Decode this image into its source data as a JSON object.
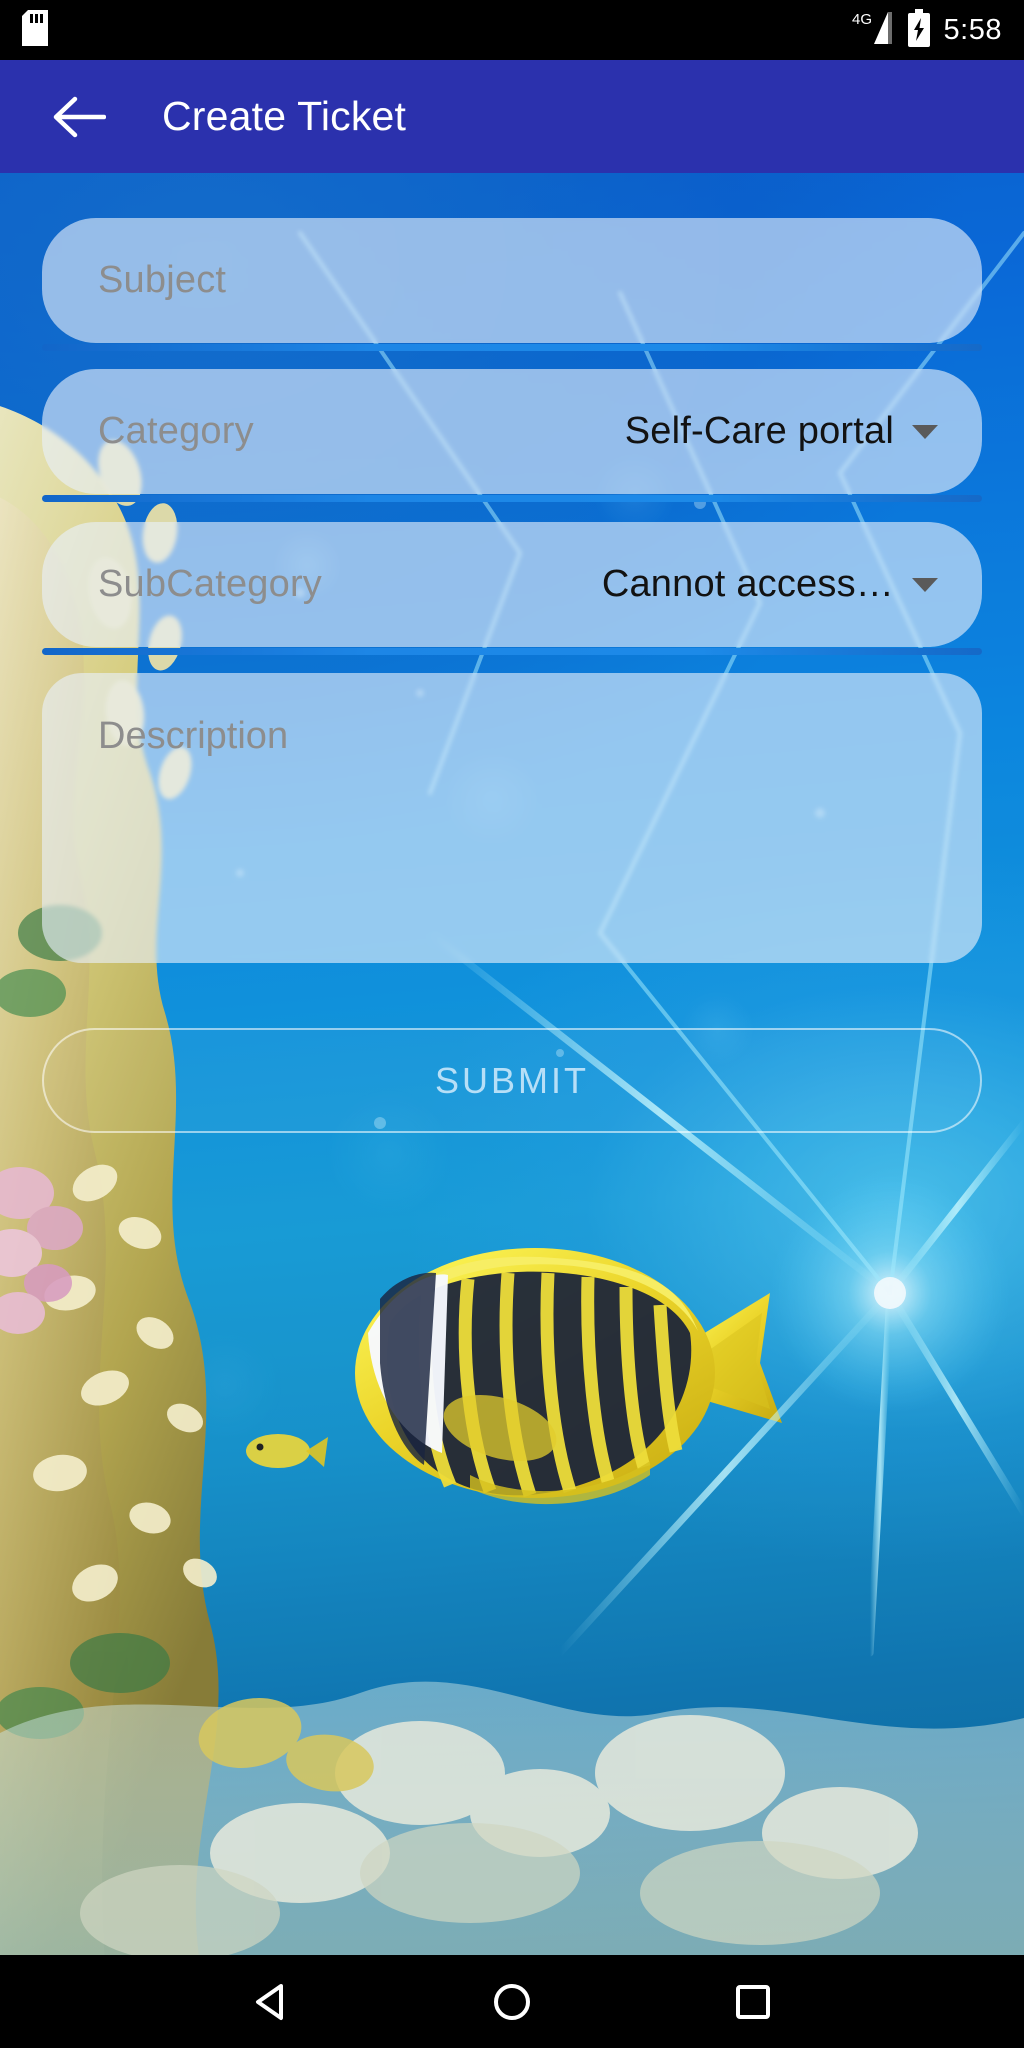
{
  "statusbar": {
    "sd_icon": "sd-card-icon",
    "network_label": "4G",
    "signal_icon": "signal-bars-icon",
    "battery_icon": "battery-charging-icon",
    "time": "5:58"
  },
  "appbar": {
    "back_icon": "back-arrow-icon",
    "title": "Create Ticket"
  },
  "form": {
    "subject": {
      "placeholder": "Subject",
      "value": ""
    },
    "category": {
      "label": "Category",
      "value": "Self-Care portal",
      "caret_icon": "chevron-down-icon"
    },
    "subcategory": {
      "label": "SubCategory",
      "value": "Cannot access…",
      "caret_icon": "chevron-down-icon"
    },
    "description": {
      "placeholder": "Description",
      "value": ""
    },
    "submit_label": "SUBMIT"
  },
  "navbar": {
    "back_icon": "nav-back-triangle-icon",
    "home_icon": "nav-home-circle-icon",
    "recents_icon": "nav-recents-square-icon"
  },
  "colors": {
    "appbar": "#2b31ad",
    "field_fill": "rgba(232,240,252,0.62)",
    "underline": "#1d86e6",
    "placeholder": "#8d8d8d",
    "value_text": "#121212"
  }
}
